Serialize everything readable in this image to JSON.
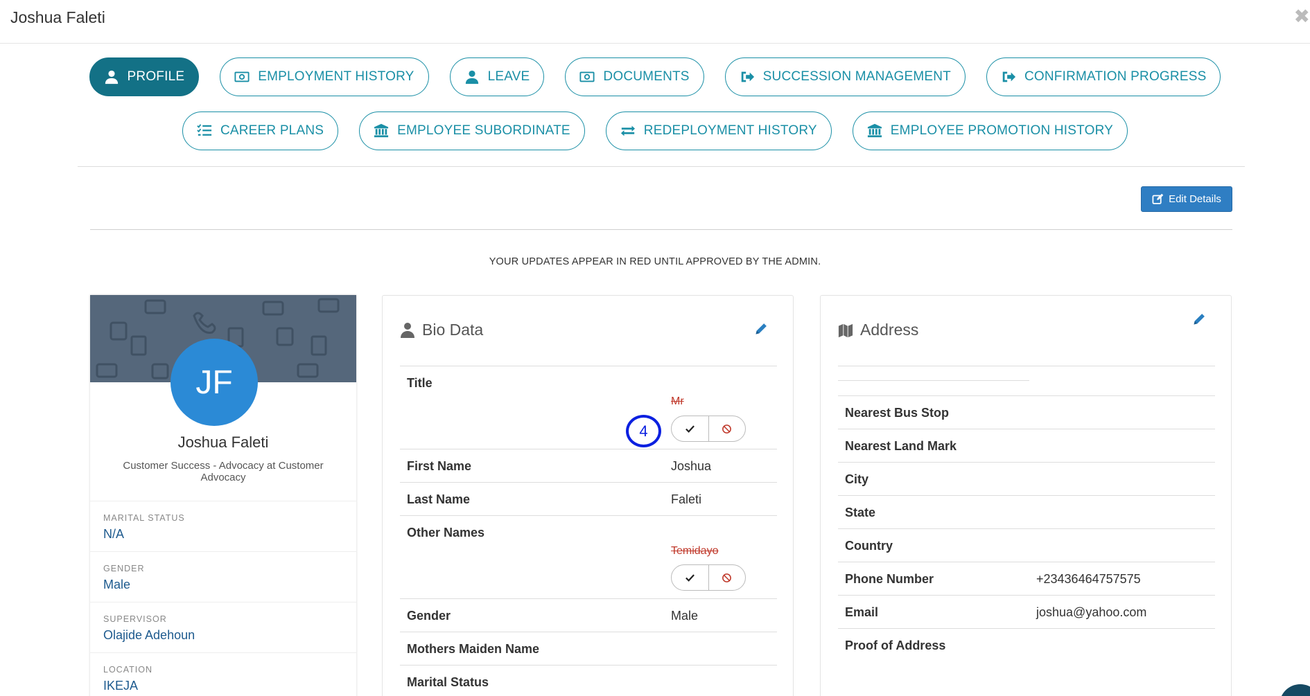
{
  "modal": {
    "title": "Joshua Faleti",
    "close_glyph": "✖"
  },
  "tabs_row1": [
    {
      "label": "PROFILE",
      "icon": "user-icon",
      "active": true
    },
    {
      "label": "EMPLOYMENT HISTORY",
      "icon": "money-icon",
      "active": false
    },
    {
      "label": "LEAVE",
      "icon": "user-icon",
      "active": false
    },
    {
      "label": "DOCUMENTS",
      "icon": "money-icon",
      "active": false
    },
    {
      "label": "SUCCESSION MANAGEMENT",
      "icon": "sign-out-icon",
      "active": false
    },
    {
      "label": "CONFIRMATION PROGRESS",
      "icon": "sign-out-icon",
      "active": false
    }
  ],
  "tabs_row2": [
    {
      "label": "CAREER PLANS",
      "icon": "list-check-icon",
      "active": false
    },
    {
      "label": "EMPLOYEE SUBORDINATE",
      "icon": "bank-icon",
      "active": false
    },
    {
      "label": "REDEPLOYMENT HISTORY",
      "icon": "exchange-icon",
      "active": false
    },
    {
      "label": "EMPLOYEE PROMOTION HISTORY",
      "icon": "bank-icon",
      "active": false
    }
  ],
  "actions": {
    "edit_details": "Edit Details"
  },
  "notice": "YOUR UPDATES APPEAR IN RED UNTIL APPROVED BY THE ADMIN.",
  "profile": {
    "initials": "JF",
    "name": "Joshua Faleti",
    "role": "Customer Success - Advocacy at Customer Advocacy",
    "fields": [
      {
        "label": "MARITAL STATUS",
        "value": "N/A"
      },
      {
        "label": "GENDER",
        "value": "Male"
      },
      {
        "label": "SUPERVISOR",
        "value": "Olajide Adehoun"
      },
      {
        "label": "LOCATION",
        "value": "IKEJA"
      }
    ]
  },
  "bio": {
    "heading": "Bio Data",
    "rows": [
      {
        "label": "Title",
        "value": "",
        "pending": "Mr"
      },
      {
        "label": "First Name",
        "value": "Joshua"
      },
      {
        "label": "Last Name",
        "value": "Faleti"
      },
      {
        "label": "Other Names",
        "value": "",
        "pending": "Temidayo"
      },
      {
        "label": "Gender",
        "value": "Male"
      },
      {
        "label": "Mothers Maiden Name",
        "value": ""
      },
      {
        "label": "Marital Status",
        "value": ""
      }
    ],
    "annotation_badge": "4"
  },
  "address": {
    "heading": "Address",
    "rows": [
      {
        "label": "Nearest Bus Stop",
        "value": ""
      },
      {
        "label": "Nearest Land Mark",
        "value": ""
      },
      {
        "label": "City",
        "value": ""
      },
      {
        "label": "State",
        "value": ""
      },
      {
        "label": "Country",
        "value": ""
      },
      {
        "label": "Phone Number",
        "value": "+23436464757575"
      },
      {
        "label": "Email",
        "value": "joshua@yahoo.com"
      },
      {
        "label": "Proof of Address",
        "value": ""
      }
    ]
  },
  "colors": {
    "brand_teal": "#1a8fa6",
    "active_tab": "#137186",
    "primary_button": "#2f7ec3",
    "pending_red": "#c0392b",
    "avatar_blue": "#2b8ad6",
    "badge_blue": "#0b20e0"
  }
}
